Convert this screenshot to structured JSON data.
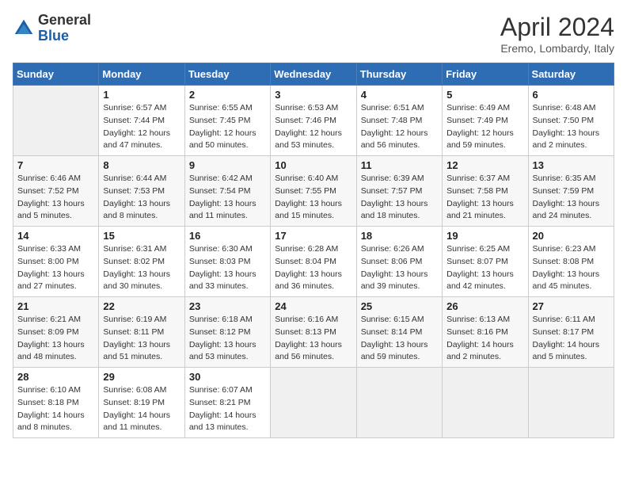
{
  "header": {
    "logo_general": "General",
    "logo_blue": "Blue",
    "title": "April 2024",
    "location": "Eremo, Lombardy, Italy"
  },
  "weekdays": [
    "Sunday",
    "Monday",
    "Tuesday",
    "Wednesday",
    "Thursday",
    "Friday",
    "Saturday"
  ],
  "weeks": [
    [
      {
        "day": "",
        "info": ""
      },
      {
        "day": "1",
        "info": "Sunrise: 6:57 AM\nSunset: 7:44 PM\nDaylight: 12 hours\nand 47 minutes."
      },
      {
        "day": "2",
        "info": "Sunrise: 6:55 AM\nSunset: 7:45 PM\nDaylight: 12 hours\nand 50 minutes."
      },
      {
        "day": "3",
        "info": "Sunrise: 6:53 AM\nSunset: 7:46 PM\nDaylight: 12 hours\nand 53 minutes."
      },
      {
        "day": "4",
        "info": "Sunrise: 6:51 AM\nSunset: 7:48 PM\nDaylight: 12 hours\nand 56 minutes."
      },
      {
        "day": "5",
        "info": "Sunrise: 6:49 AM\nSunset: 7:49 PM\nDaylight: 12 hours\nand 59 minutes."
      },
      {
        "day": "6",
        "info": "Sunrise: 6:48 AM\nSunset: 7:50 PM\nDaylight: 13 hours\nand 2 minutes."
      }
    ],
    [
      {
        "day": "7",
        "info": "Sunrise: 6:46 AM\nSunset: 7:52 PM\nDaylight: 13 hours\nand 5 minutes."
      },
      {
        "day": "8",
        "info": "Sunrise: 6:44 AM\nSunset: 7:53 PM\nDaylight: 13 hours\nand 8 minutes."
      },
      {
        "day": "9",
        "info": "Sunrise: 6:42 AM\nSunset: 7:54 PM\nDaylight: 13 hours\nand 11 minutes."
      },
      {
        "day": "10",
        "info": "Sunrise: 6:40 AM\nSunset: 7:55 PM\nDaylight: 13 hours\nand 15 minutes."
      },
      {
        "day": "11",
        "info": "Sunrise: 6:39 AM\nSunset: 7:57 PM\nDaylight: 13 hours\nand 18 minutes."
      },
      {
        "day": "12",
        "info": "Sunrise: 6:37 AM\nSunset: 7:58 PM\nDaylight: 13 hours\nand 21 minutes."
      },
      {
        "day": "13",
        "info": "Sunrise: 6:35 AM\nSunset: 7:59 PM\nDaylight: 13 hours\nand 24 minutes."
      }
    ],
    [
      {
        "day": "14",
        "info": "Sunrise: 6:33 AM\nSunset: 8:00 PM\nDaylight: 13 hours\nand 27 minutes."
      },
      {
        "day": "15",
        "info": "Sunrise: 6:31 AM\nSunset: 8:02 PM\nDaylight: 13 hours\nand 30 minutes."
      },
      {
        "day": "16",
        "info": "Sunrise: 6:30 AM\nSunset: 8:03 PM\nDaylight: 13 hours\nand 33 minutes."
      },
      {
        "day": "17",
        "info": "Sunrise: 6:28 AM\nSunset: 8:04 PM\nDaylight: 13 hours\nand 36 minutes."
      },
      {
        "day": "18",
        "info": "Sunrise: 6:26 AM\nSunset: 8:06 PM\nDaylight: 13 hours\nand 39 minutes."
      },
      {
        "day": "19",
        "info": "Sunrise: 6:25 AM\nSunset: 8:07 PM\nDaylight: 13 hours\nand 42 minutes."
      },
      {
        "day": "20",
        "info": "Sunrise: 6:23 AM\nSunset: 8:08 PM\nDaylight: 13 hours\nand 45 minutes."
      }
    ],
    [
      {
        "day": "21",
        "info": "Sunrise: 6:21 AM\nSunset: 8:09 PM\nDaylight: 13 hours\nand 48 minutes."
      },
      {
        "day": "22",
        "info": "Sunrise: 6:19 AM\nSunset: 8:11 PM\nDaylight: 13 hours\nand 51 minutes."
      },
      {
        "day": "23",
        "info": "Sunrise: 6:18 AM\nSunset: 8:12 PM\nDaylight: 13 hours\nand 53 minutes."
      },
      {
        "day": "24",
        "info": "Sunrise: 6:16 AM\nSunset: 8:13 PM\nDaylight: 13 hours\nand 56 minutes."
      },
      {
        "day": "25",
        "info": "Sunrise: 6:15 AM\nSunset: 8:14 PM\nDaylight: 13 hours\nand 59 minutes."
      },
      {
        "day": "26",
        "info": "Sunrise: 6:13 AM\nSunset: 8:16 PM\nDaylight: 14 hours\nand 2 minutes."
      },
      {
        "day": "27",
        "info": "Sunrise: 6:11 AM\nSunset: 8:17 PM\nDaylight: 14 hours\nand 5 minutes."
      }
    ],
    [
      {
        "day": "28",
        "info": "Sunrise: 6:10 AM\nSunset: 8:18 PM\nDaylight: 14 hours\nand 8 minutes."
      },
      {
        "day": "29",
        "info": "Sunrise: 6:08 AM\nSunset: 8:19 PM\nDaylight: 14 hours\nand 11 minutes."
      },
      {
        "day": "30",
        "info": "Sunrise: 6:07 AM\nSunset: 8:21 PM\nDaylight: 14 hours\nand 13 minutes."
      },
      {
        "day": "",
        "info": ""
      },
      {
        "day": "",
        "info": ""
      },
      {
        "day": "",
        "info": ""
      },
      {
        "day": "",
        "info": ""
      }
    ]
  ]
}
